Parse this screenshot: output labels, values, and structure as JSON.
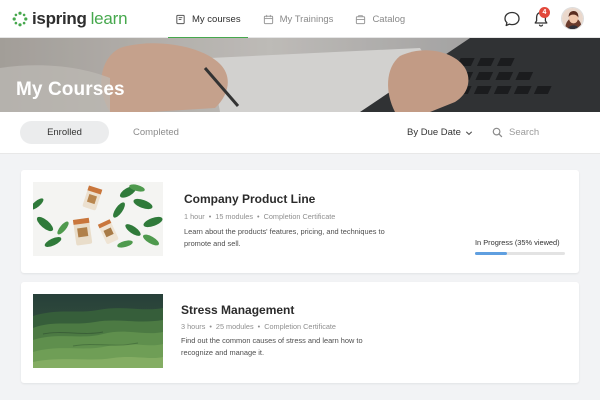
{
  "header": {
    "logo_brand": "ispring",
    "logo_learn": "learn",
    "notification_count": "4",
    "accent_color": "#46a84d"
  },
  "nav": [
    {
      "label": "My courses",
      "icon": "book-icon",
      "active": true
    },
    {
      "label": "My Trainings",
      "icon": "calendar-icon",
      "active": false
    },
    {
      "label": "Catalog",
      "icon": "catalog-icon",
      "active": false
    }
  ],
  "hero": {
    "title": "My Courses"
  },
  "filters": {
    "tabs": [
      {
        "label": "Enrolled",
        "selected": true
      },
      {
        "label": "Completed",
        "selected": false
      }
    ],
    "sort_label": "By Due Date",
    "search_placeholder": "Search"
  },
  "courses": [
    {
      "title": "Company Product Line",
      "duration": "1 hour",
      "modules": "15 modules",
      "certificate": "Completion Certificate",
      "description": "Learn about the products' features, pricing, and techniques to promote and sell.",
      "progress_label": "In Progress (35% viewed)",
      "progress_fraction": 0.35,
      "thumbnail": "product-bottles-plant-image"
    },
    {
      "title": "Stress Management",
      "duration": "3 hours",
      "modules": "25 modules",
      "certificate": "Completion Certificate",
      "description": "Find out the common causes of stress and learn how to recognize and manage it.",
      "thumbnail": "green-hills-landscape-image"
    }
  ],
  "colors": {
    "progress": "#5f9fe0",
    "badge": "#e2493c",
    "page_background": "#f2f3f5"
  }
}
